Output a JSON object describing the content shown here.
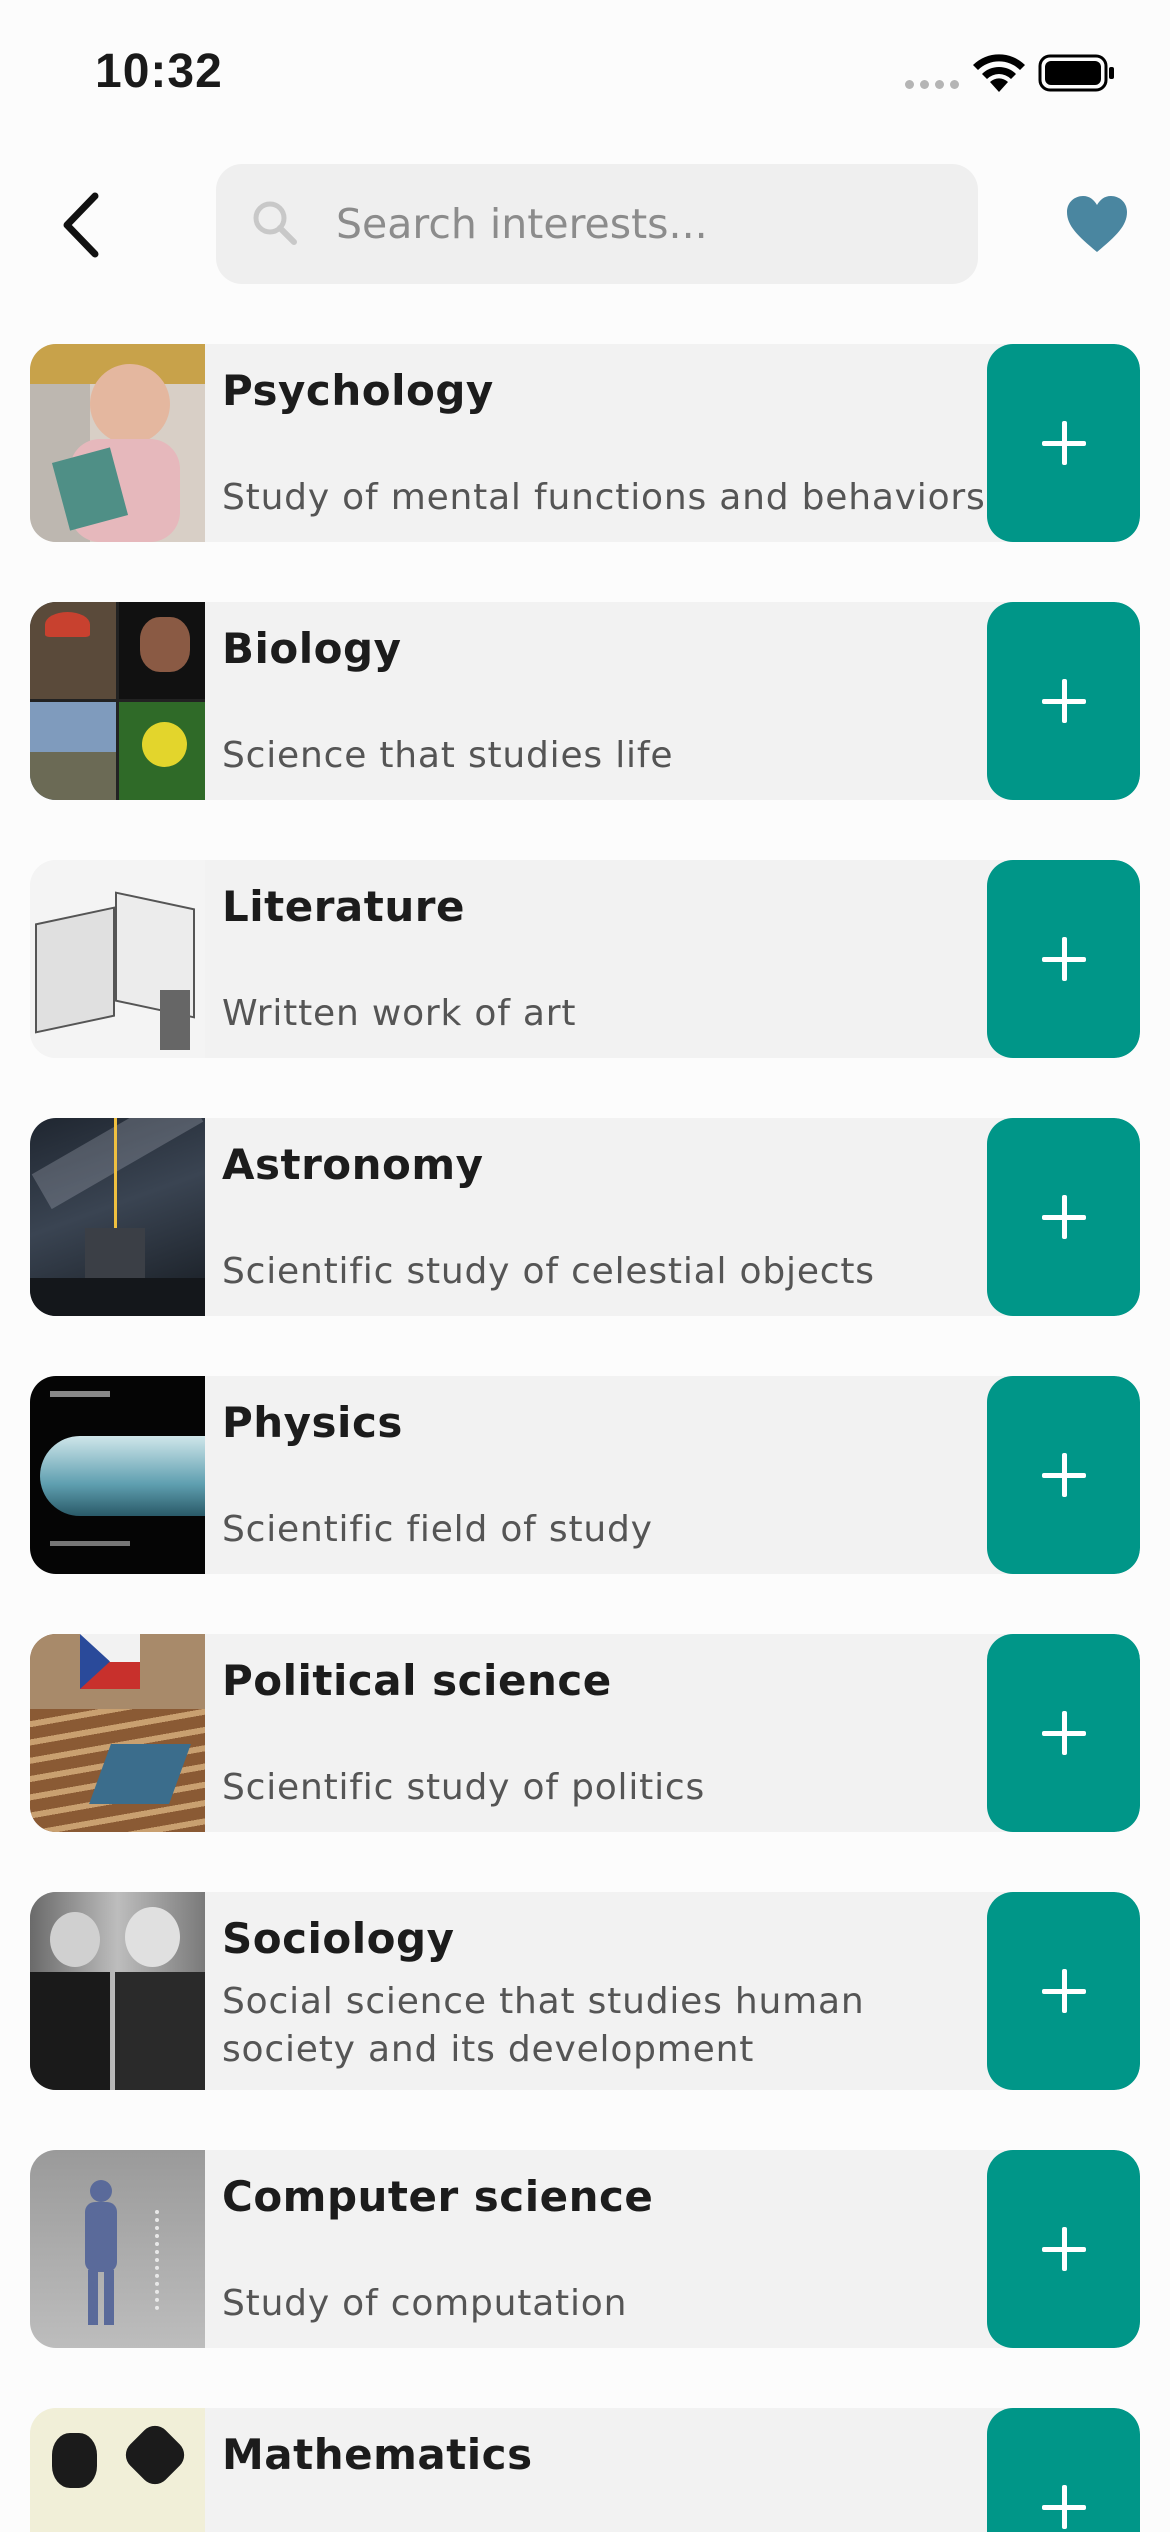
{
  "status_bar": {
    "time": "10:32",
    "signal_icon": "signal-dots-icon",
    "wifi_icon": "wifi-icon",
    "battery_icon": "battery-icon"
  },
  "header": {
    "back_icon": "chevron-left-icon",
    "search_placeholder": "Search interests...",
    "search_value": "",
    "favorites_icon": "heart-icon",
    "favorites_color": "#4a86a0"
  },
  "colors": {
    "accent": "#009688",
    "card_background": "#f2f2f2"
  },
  "interests": [
    {
      "title": "Psychology",
      "description": "Study of mental functions and behaviors",
      "action_icon": "plus-icon"
    },
    {
      "title": "Biology",
      "description": "Science that studies life",
      "action_icon": "plus-icon"
    },
    {
      "title": "Literature",
      "description": "Written work of art",
      "action_icon": "plus-icon"
    },
    {
      "title": "Astronomy",
      "description": "Scientific study of celestial objects",
      "action_icon": "plus-icon"
    },
    {
      "title": "Physics",
      "description": "Scientific field of study",
      "action_icon": "plus-icon"
    },
    {
      "title": "Political science",
      "description": "Scientific study of politics",
      "action_icon": "plus-icon"
    },
    {
      "title": "Sociology",
      "description": "Social science that studies human society and its development",
      "action_icon": "plus-icon"
    },
    {
      "title": "Computer science",
      "description": "Study of computation",
      "action_icon": "plus-icon"
    },
    {
      "title": "Mathematics",
      "description": "",
      "action_icon": "plus-icon"
    }
  ]
}
